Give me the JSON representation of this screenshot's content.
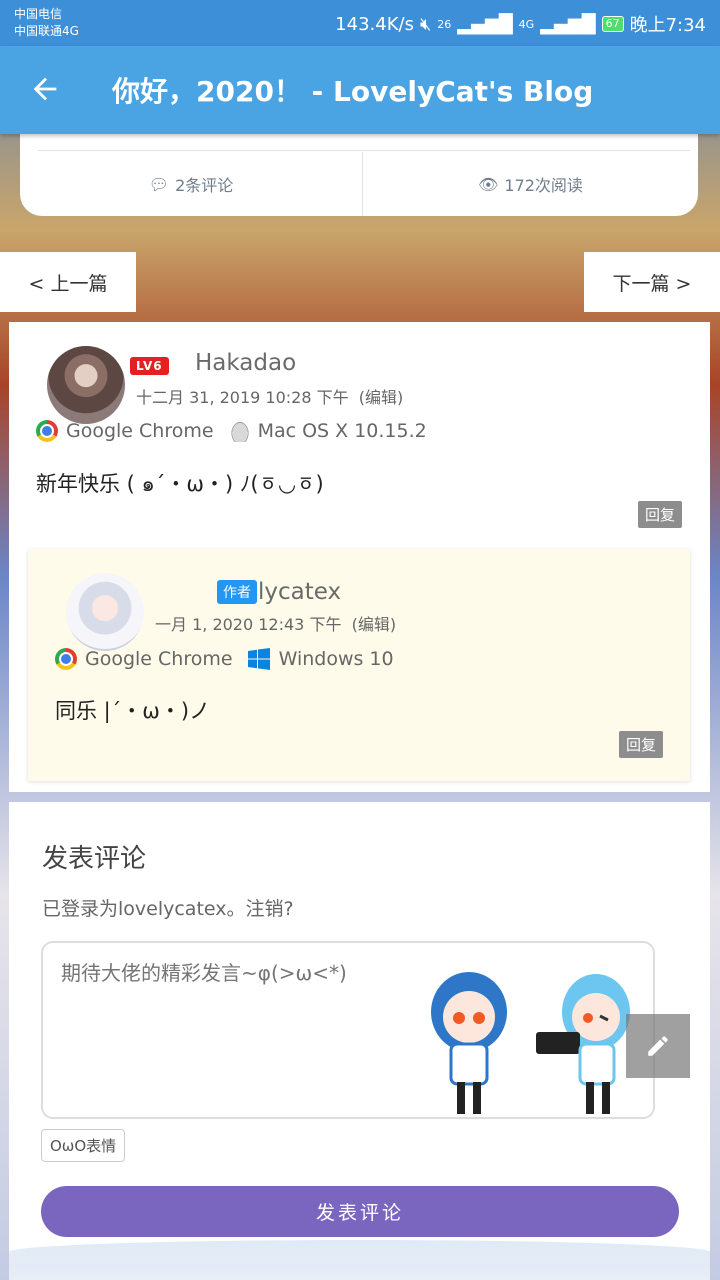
{
  "status_bar": {
    "carrier1": "中国电信",
    "carrier2": "中国联通4G",
    "speed": "143.4K/s",
    "signal1": "26",
    "signal2": "4G",
    "battery": "67",
    "time": "晚上7:34"
  },
  "app_bar": {
    "title": "你好，2020！ - LovelyCat's Blog",
    "back_icon": "arrow-left-icon"
  },
  "post_stats": {
    "comments": "2条评论",
    "views": "172次阅读"
  },
  "pager": {
    "prev": "< 上一篇",
    "next": "下一篇 >"
  },
  "comments": [
    {
      "author": "Hakadao",
      "level": "LV6",
      "date": "十二月 31, 2019 10:28 下午",
      "edit": "(编辑)",
      "browser": "Google Chrome",
      "os": "Mac OS X 10.15.2",
      "text": "新年快乐 ( ๑´・ω・) ﾉ(ㆆ◡ㆆ)",
      "reply": "回复"
    },
    {
      "author": "lycatex",
      "author_badge": "作者",
      "date": "一月 1, 2020 12:43 下午",
      "edit": "(编辑)",
      "browser": "Google Chrome",
      "os": "Windows 10",
      "text": "同乐 |´・ω・)ノ",
      "reply": "回复"
    }
  ],
  "comment_form": {
    "heading": "发表评论",
    "logged_in": "已登录为lovelycatex。注销?",
    "placeholder": "期待大佬的精彩发言~φ(>ω<*)",
    "owo_button": "OωO表情",
    "submit": "发表评论"
  },
  "colors": {
    "status_bar": "#3d8fd8",
    "app_bar": "#4aa3e2",
    "level_badge": "#e62020",
    "author_badge": "#2196f3",
    "submit": "#7a66bf",
    "reply_bg": "#fffbea"
  }
}
